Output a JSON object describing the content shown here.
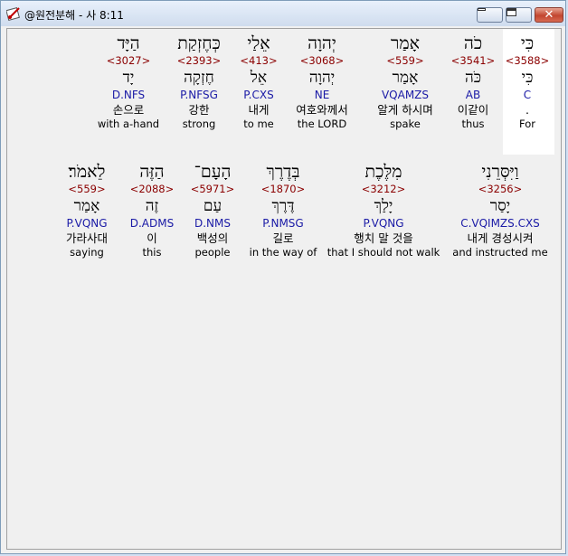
{
  "window": {
    "title": "@원전분해 - 사 8:11"
  },
  "rows": [
    [
      {
        "heb": "כִּי",
        "strong": "<3588>",
        "lemma": "כִּי",
        "code": "C",
        "kor": ".",
        "eng": "For"
      },
      {
        "heb": "כֹה",
        "strong": "<3541>",
        "lemma": "כֹּה",
        "code": "AB",
        "kor": "이같이",
        "eng": "thus"
      },
      {
        "heb": "אָמַר",
        "strong": "<559>",
        "lemma": "אָמַר",
        "code": "VQAMZS",
        "kor": "알게 하시며",
        "eng": "spake"
      },
      {
        "heb": "יְהוָה",
        "strong": "<3068>",
        "lemma": "יְהוָה",
        "code": "NE",
        "kor": "여호와께서",
        "eng": "the LORD"
      },
      {
        "heb": "אֵלַי",
        "strong": "<413>",
        "lemma": "אֵל",
        "code": "P.CXS",
        "kor": "내게",
        "eng": "to me"
      },
      {
        "heb": "כְּחֶזְקַת",
        "strong": "<2393>",
        "lemma": "חֶזְקָה",
        "code": "P.NFSG",
        "kor": "강한",
        "eng": "strong"
      },
      {
        "heb": "הַיָּד",
        "strong": "<3027>",
        "lemma": "יָד",
        "code": "D.NFS",
        "kor": "손으로",
        "eng": "with a-hand"
      }
    ],
    [
      {
        "heb": "וַיִּסְּרֵנִי",
        "strong": "<3256>",
        "lemma": "יָסַר",
        "code": "C.VQIMZS.CXS",
        "kor": "내게 경성시켜",
        "eng": "and instructed me"
      },
      {
        "heb": "מִלֶּכֶת",
        "strong": "<3212>",
        "lemma": "יָלַךְ",
        "code": "P.VQNG",
        "kor": "행치 말 것을",
        "eng": "that I should not walk"
      },
      {
        "heb": "בְּדֶרֶךְ",
        "strong": "<1870>",
        "lemma": "דֶּרֶךְ",
        "code": "P.NMSG",
        "kor": "길로",
        "eng": "in the way of"
      },
      {
        "heb": "הָעָם־",
        "strong": "<5971>",
        "lemma": "עַם",
        "code": "D.NMS",
        "kor": "백성의",
        "eng": "people"
      },
      {
        "heb": "הַזֶּה",
        "strong": "<2088>",
        "lemma": "זֶה",
        "code": "D.ADMS",
        "kor": "이",
        "eng": "this"
      },
      {
        "heb": "לֵאמֹר׃",
        "strong": "<559>",
        "lemma": "אָמַר",
        "code": "P.VQNG",
        "kor": "가라사대",
        "eng": "saying"
      }
    ]
  ]
}
